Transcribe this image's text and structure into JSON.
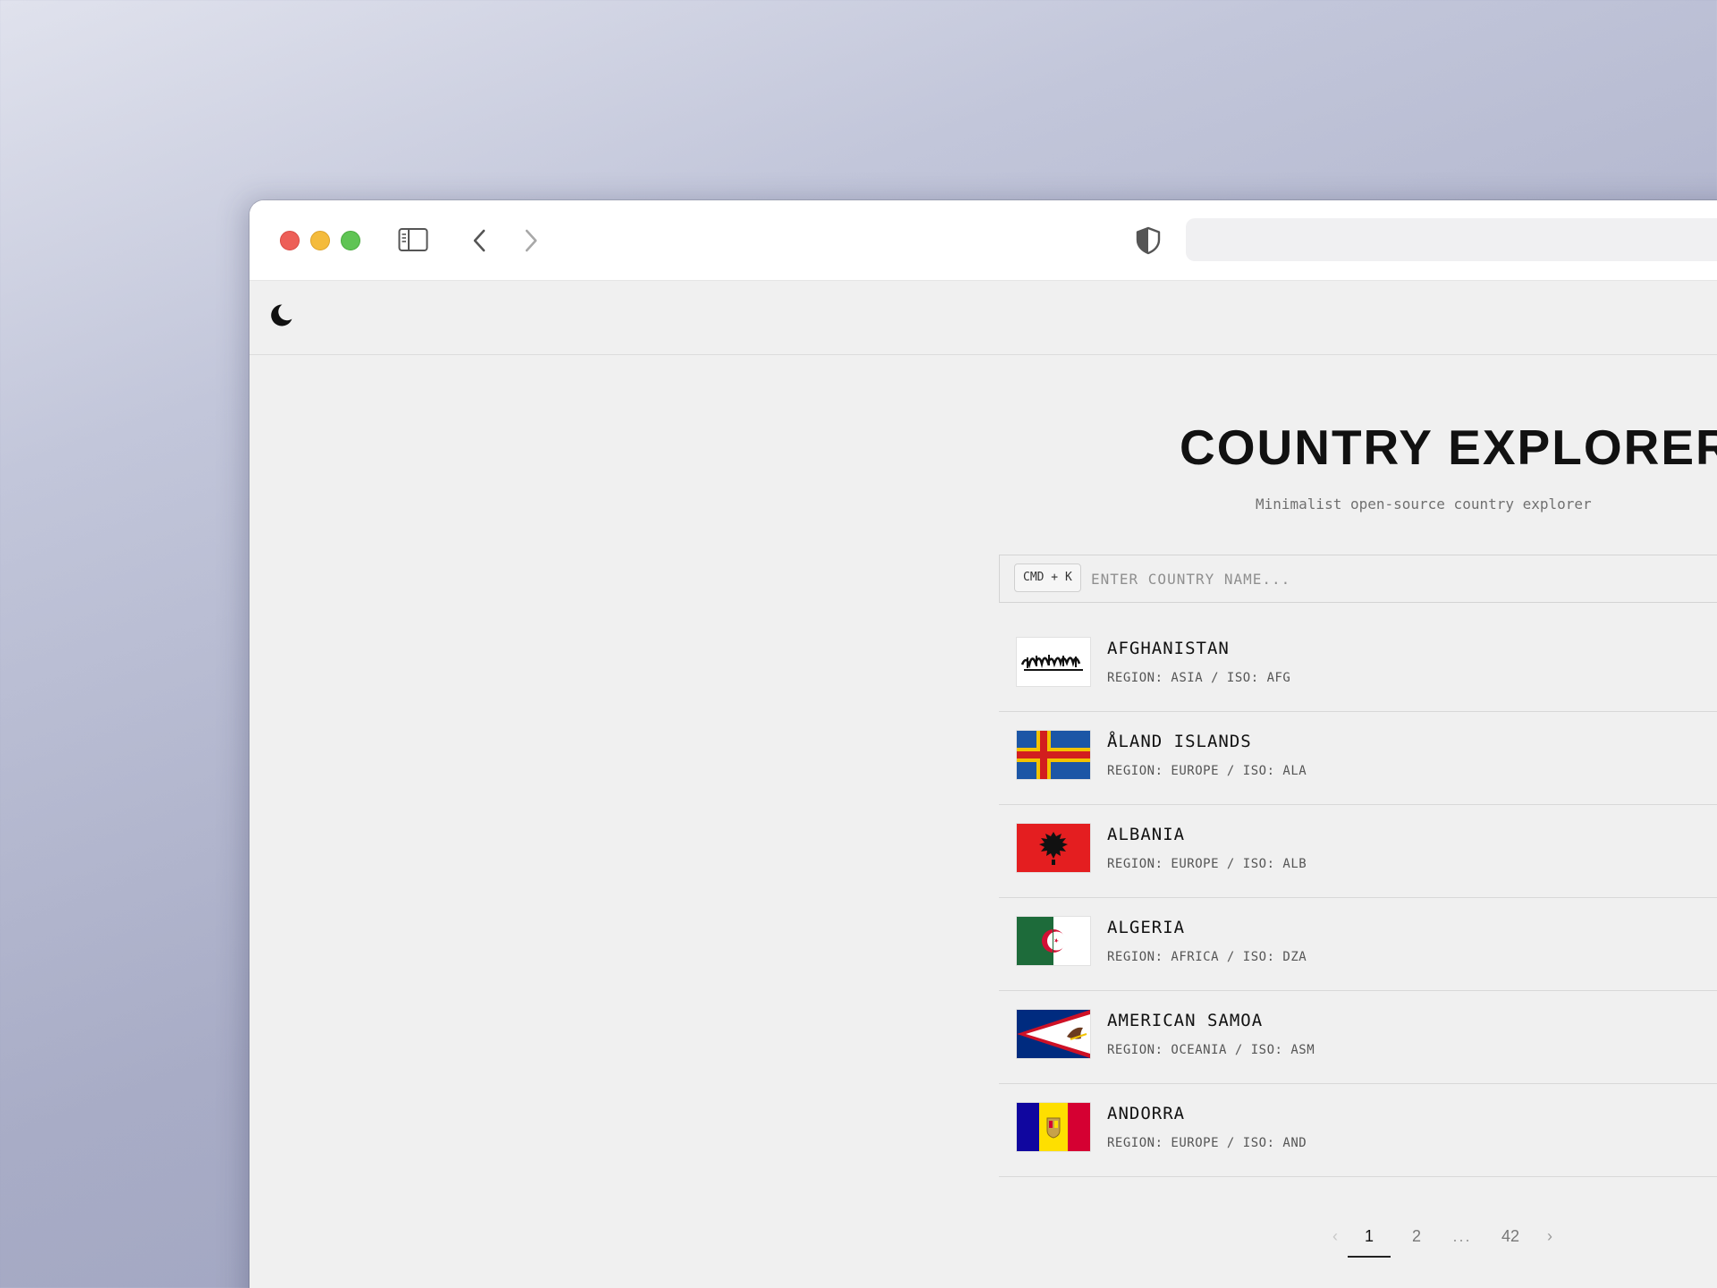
{
  "browser": {
    "controls": [
      "close",
      "minimize",
      "zoom"
    ],
    "icons": [
      "sidebar-toggle-icon",
      "back-arrow-icon",
      "forward-arrow-icon",
      "shield-icon"
    ],
    "address": ""
  },
  "app": {
    "theme_icon": "moon-icon",
    "title": "COUNTRY EXPLORER",
    "subtitle": "Minimalist open-source country explorer"
  },
  "search": {
    "shortcut": "CMD + K",
    "placeholder": "ENTER COUNTRY NAME..."
  },
  "countries": [
    {
      "name": "AFGHANISTAN",
      "meta": "REGION: ASIA / ISO: AFG",
      "flag": "afghanistan-flag-icon"
    },
    {
      "name": "ÅLAND ISLANDS",
      "meta": "REGION: EUROPE / ISO: ALA",
      "flag": "aland-islands-flag-icon"
    },
    {
      "name": "ALBANIA",
      "meta": "REGION: EUROPE / ISO: ALB",
      "flag": "albania-flag-icon"
    },
    {
      "name": "ALGERIA",
      "meta": "REGION: AFRICA / ISO: DZA",
      "flag": "algeria-flag-icon"
    },
    {
      "name": "AMERICAN SAMOA",
      "meta": "REGION: OCEANIA / ISO: ASM",
      "flag": "american-samoa-flag-icon"
    },
    {
      "name": "ANDORRA",
      "meta": "REGION: EUROPE / ISO: AND",
      "flag": "andorra-flag-icon"
    }
  ],
  "pagination": {
    "prev": "‹",
    "pages": [
      "1",
      "2"
    ],
    "ellipsis": "...",
    "last": "42",
    "next": "›",
    "current": "1"
  },
  "colors": {
    "window_bg": "#f0f0f0",
    "traffic_red": "#ed5f58",
    "traffic_yellow": "#f4bb3c",
    "traffic_green": "#5fc454"
  }
}
